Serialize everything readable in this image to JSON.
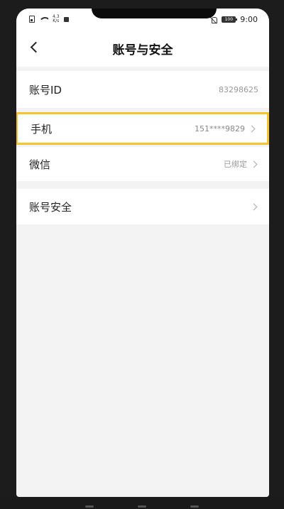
{
  "status_bar": {
    "speed_value": "4.3",
    "speed_unit": "K/s",
    "battery": "100",
    "time": "9:00"
  },
  "header": {
    "title": "账号与安全"
  },
  "rows": [
    {
      "label": "账号ID",
      "value": "83298625",
      "chevron": false
    },
    {
      "label": "手机",
      "value": "151****9829",
      "chevron": true,
      "highlighted": true,
      "highlight_color": "#f6c42b"
    },
    {
      "label": "微信",
      "value": "已绑定",
      "chevron": true
    },
    {
      "label": "账号安全",
      "value": "",
      "chevron": true
    }
  ]
}
